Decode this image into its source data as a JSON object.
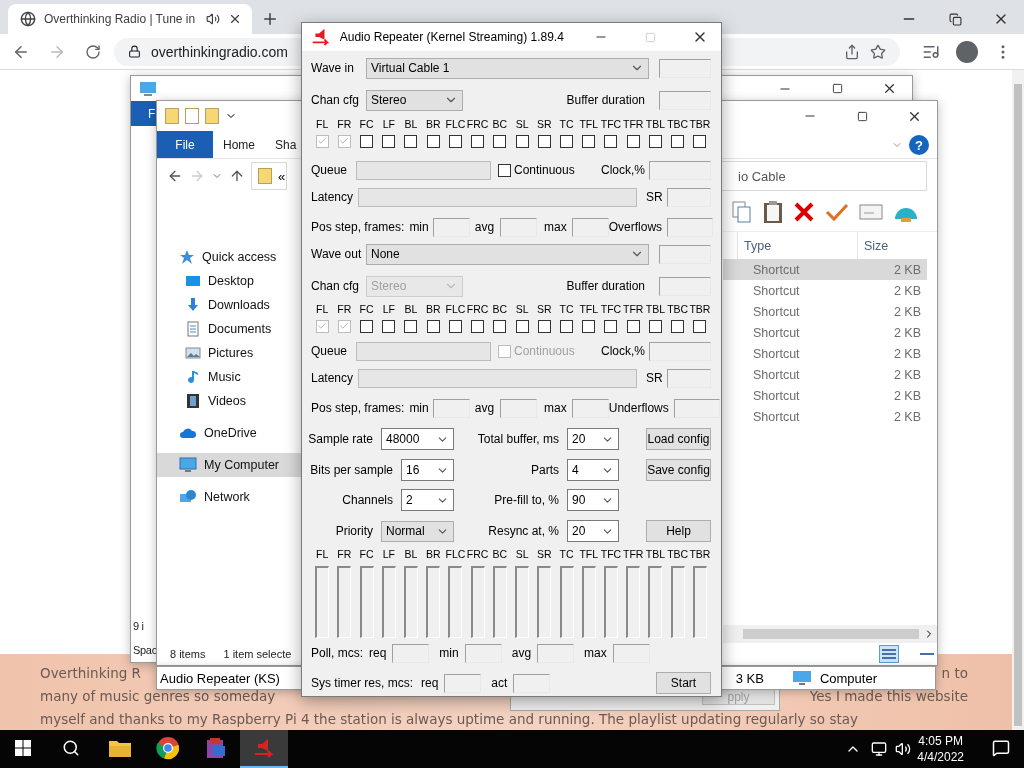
{
  "browser": {
    "tab": {
      "title": "Overthinking Radio | Tune in",
      "selected": true
    },
    "url": "overthinkingradio.com",
    "page_lines": [
      [
        "Overthinking R",
        "n to"
      ],
      [
        "many of music genres so someday",
        "Yes I made this website"
      ],
      [
        "myself and thanks to my Raspberry Pi 4 the station is always uptime and running. The playlist updating regularly so stay"
      ]
    ]
  },
  "explorer_back": {
    "file_tab": "F",
    "status": [
      "9 i",
      "Spac"
    ]
  },
  "explorer": {
    "ribbon_tabs": [
      {
        "label": "File",
        "selected": true
      },
      {
        "label": "Home",
        "selected": false
      },
      {
        "label": "Sha",
        "selected": false
      }
    ],
    "help_icon": "?",
    "address": "«",
    "search": "io Cable",
    "nav": [
      {
        "label": "Quick access",
        "kind": "star",
        "selected": false,
        "children": [
          {
            "label": "Desktop",
            "kind": "desktop",
            "selected": false
          },
          {
            "label": "Downloads",
            "kind": "download",
            "selected": false
          },
          {
            "label": "Documents",
            "kind": "document",
            "selected": false
          },
          {
            "label": "Pictures",
            "kind": "picture",
            "selected": false
          },
          {
            "label": "Music",
            "kind": "music",
            "selected": false
          },
          {
            "label": "Videos",
            "kind": "video",
            "selected": false
          }
        ]
      },
      {
        "label": "OneDrive",
        "kind": "cloud",
        "selected": false
      },
      {
        "label": "My Computer",
        "kind": "computer",
        "selected": true
      },
      {
        "label": "Network",
        "kind": "network",
        "selected": false
      }
    ],
    "columns": [
      "Type",
      "Size"
    ],
    "rows": [
      {
        "type": "Shortcut",
        "size": "2 KB",
        "selected": true
      },
      {
        "type": "Shortcut",
        "size": "2 KB",
        "selected": false
      },
      {
        "type": "Shortcut",
        "size": "2 KB",
        "selected": false
      },
      {
        "type": "Shortcut",
        "size": "2 KB",
        "selected": false
      },
      {
        "type": "Shortcut",
        "size": "2 KB",
        "selected": false
      },
      {
        "type": "Shortcut",
        "size": "2 KB",
        "selected": false
      },
      {
        "type": "Shortcut",
        "size": "2 KB",
        "selected": false
      },
      {
        "type": "Shortcut",
        "size": "2 KB",
        "selected": false
      }
    ],
    "status": [
      "8 items",
      "1 item selecte"
    ]
  },
  "details": {
    "name": "Audio Repeater (KS)",
    "size": "3 KB",
    "location": "Computer"
  },
  "back_dialog": {
    "button": {
      "label": "pply",
      "disabled": true
    }
  },
  "repeater": {
    "title": "Audio Repeater (Kernel Streaming) 1.89.4",
    "sections": [
      {
        "device_label": "Wave in",
        "device": "Virtual Cable 1",
        "chan_label": "Chan cfg",
        "chan_cfg": "Stereo",
        "chan_disabled": false,
        "buffer_label": "Buffer duration",
        "channels": [
          {
            "label": "FL",
            "checked": true,
            "disabled": true
          },
          {
            "label": "FR",
            "checked": true,
            "disabled": true
          },
          {
            "label": "FC",
            "checked": false,
            "disabled": false
          },
          {
            "label": "LF",
            "checked": false,
            "disabled": false
          },
          {
            "label": "BL",
            "checked": false,
            "disabled": false
          },
          {
            "label": "BR",
            "checked": false,
            "disabled": false
          },
          {
            "label": "FLC",
            "checked": false,
            "disabled": false
          },
          {
            "label": "FRC",
            "checked": false,
            "disabled": false
          },
          {
            "label": "BC",
            "checked": false,
            "disabled": false
          },
          {
            "label": "SL",
            "checked": false,
            "disabled": false
          },
          {
            "label": "SR",
            "checked": false,
            "disabled": false
          },
          {
            "label": "TC",
            "checked": false,
            "disabled": false
          },
          {
            "label": "TFL",
            "checked": false,
            "disabled": false
          },
          {
            "label": "TFC",
            "checked": false,
            "disabled": false
          },
          {
            "label": "TFR",
            "checked": false,
            "disabled": false
          },
          {
            "label": "TBL",
            "checked": false,
            "disabled": false
          },
          {
            "label": "TBC",
            "checked": false,
            "disabled": false
          },
          {
            "label": "TBR",
            "checked": false,
            "disabled": false
          }
        ],
        "queue_label": "Queue",
        "continuous": {
          "label": "Continuous",
          "checked": false,
          "disabled": false
        },
        "clock_label": "Clock,%",
        "latency_label": "Latency",
        "sr_label": "SR",
        "pos_label": "Pos step, frames:",
        "min": "min",
        "avg": "avg",
        "max": "max",
        "flows_label": "Overflows"
      },
      {
        "device_label": "Wave out",
        "device": "None",
        "chan_label": "Chan cfg",
        "chan_cfg": "Stereo",
        "chan_disabled": true,
        "buffer_label": "Buffer duration",
        "channels": [
          {
            "label": "FL",
            "checked": true,
            "disabled": true
          },
          {
            "label": "FR",
            "checked": true,
            "disabled": true
          },
          {
            "label": "FC",
            "checked": false,
            "disabled": false
          },
          {
            "label": "LF",
            "checked": false,
            "disabled": false
          },
          {
            "label": "BL",
            "checked": false,
            "disabled": false
          },
          {
            "label": "BR",
            "checked": false,
            "disabled": false
          },
          {
            "label": "FLC",
            "checked": false,
            "disabled": false
          },
          {
            "label": "FRC",
            "checked": false,
            "disabled": false
          },
          {
            "label": "BC",
            "checked": false,
            "disabled": false
          },
          {
            "label": "SL",
            "checked": false,
            "disabled": false
          },
          {
            "label": "SR",
            "checked": false,
            "disabled": false
          },
          {
            "label": "TC",
            "checked": false,
            "disabled": false
          },
          {
            "label": "TFL",
            "checked": false,
            "disabled": false
          },
          {
            "label": "TFC",
            "checked": false,
            "disabled": false
          },
          {
            "label": "TFR",
            "checked": false,
            "disabled": false
          },
          {
            "label": "TBL",
            "checked": false,
            "disabled": false
          },
          {
            "label": "TBC",
            "checked": false,
            "disabled": false
          },
          {
            "label": "TBR",
            "checked": false,
            "disabled": false
          }
        ],
        "queue_label": "Queue",
        "continuous": {
          "label": "Continuous",
          "checked": false,
          "disabled": true
        },
        "clock_label": "Clock,%",
        "latency_label": "Latency",
        "sr_label": "SR",
        "pos_label": "Pos step, frames:",
        "min": "min",
        "avg": "avg",
        "max": "max",
        "flows_label": "Underflows"
      }
    ],
    "settings": [
      {
        "left": {
          "label": "Sample rate",
          "value": "48000",
          "kind": "combo"
        },
        "mid": {
          "label": "Total buffer, ms",
          "value": "20"
        },
        "button": "Load config"
      },
      {
        "left": {
          "label": "Bits per sample",
          "value": "16",
          "kind": "combo"
        },
        "mid": {
          "label": "Parts",
          "value": "4"
        },
        "button": "Save config"
      },
      {
        "left": {
          "label": "Channels",
          "value": "2",
          "kind": "combo"
        },
        "mid": {
          "label": "Pre-fill to, %",
          "value": "90"
        }
      },
      {
        "left": {
          "label": "Priority",
          "value": "Normal",
          "kind": "list"
        },
        "mid": {
          "label": "Resync at, %",
          "value": "20"
        },
        "button": "Help"
      }
    ],
    "meters": [
      "FL",
      "FR",
      "FC",
      "LF",
      "BL",
      "BR",
      "FLC",
      "FRC",
      "BC",
      "SL",
      "SR",
      "TC",
      "TFL",
      "TFC",
      "TFR",
      "TBL",
      "TBC",
      "TBR"
    ],
    "poll": {
      "label": "Poll, mcs:",
      "fields": [
        "req",
        "min",
        "avg",
        "max"
      ]
    },
    "timer": {
      "label": "Sys timer res, mcs:",
      "fields": [
        "req",
        "act"
      ]
    },
    "start": "Start"
  },
  "taskbar": {
    "apps": [
      {
        "kind": "folder",
        "selected": false
      },
      {
        "kind": "browser",
        "selected": false
      },
      {
        "kind": "archive",
        "selected": false
      },
      {
        "kind": "repeater",
        "selected": true
      }
    ],
    "time": "4:05 PM",
    "date": "4/4/2022"
  }
}
